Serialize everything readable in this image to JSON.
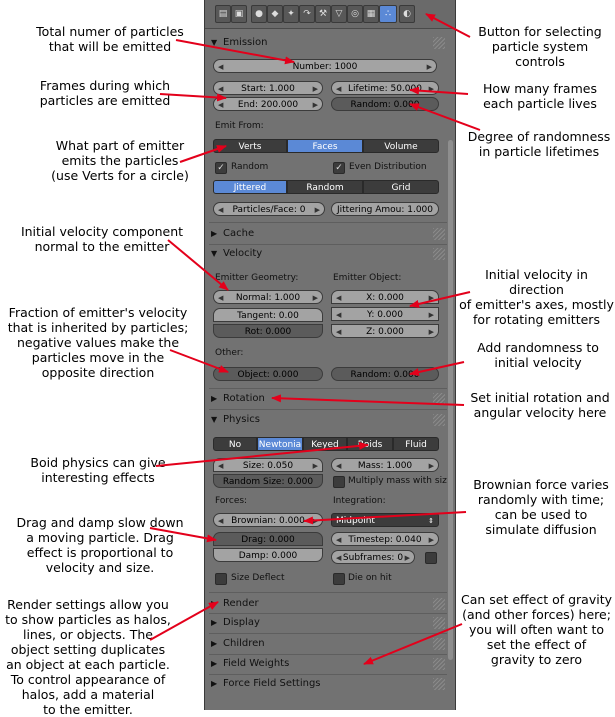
{
  "annotations": {
    "total_particles": "Total numer of particles\nthat will be emitted",
    "frames_emitted": "Frames during which\nparticles are emitted",
    "emitter_part": "What part of emitter\nemits the particles\n(use Verts for a circle)",
    "initial_velocity_normal": "Initial velocity component\nnormal to the emitter",
    "fraction_velocity": "Fraction of emitter's velocity\nthat is inherited by particles;\nnegative values make the\nparticles move in the\nopposite direction",
    "boid": "Boid physics can give\ninteresting effects",
    "drag_damp": "Drag and damp slow down\na moving particle.  Drag\neffect is proportional to\nvelocity and size.",
    "render": "Render settings allow you\nto show particles as halos,\nlines, or objects.  The\nobject setting duplicates\nan object at each particle.\nTo control appearance of\nhalos, add a material\nto the emitter.",
    "button_select": "Button for selecting\nparticle system controls",
    "frames_lives": "How many frames\neach particle lives",
    "randomness_lifetime": "Degree of randomness\nin particle lifetimes",
    "emitter_axes": "Initial velocity in direction\nof emitter's axes, mostly\nfor rotating emitters",
    "add_randomness": "Add randomness to\ninitial velocity",
    "rotation": "Set initial rotation and\nangular velocity here",
    "brownian": "Brownian force varies\nrandomly with time;\ncan be used to\nsimulate diffusion",
    "gravity": "Can set effect of gravity\n(and other forces) here;\nyou will often want to\nset the effect of\ngravity to zero"
  },
  "panel": {
    "tabs": [
      "▤",
      "▣",
      "●",
      "◆",
      "✦",
      "↷",
      "⚒",
      "▽",
      "◎",
      "▦",
      "∴",
      "◐"
    ],
    "emission": {
      "title": "Emission",
      "number": "Number: 1000",
      "start": "Start: 1.000",
      "end": "End: 200.000",
      "lifetime": "Lifetime: 50.000",
      "random": "Random: 0.000",
      "emit_from": "Emit From:",
      "emit_options": [
        "Verts",
        "Faces",
        "Volume"
      ],
      "random_check": "Random",
      "even_distribution": "Even Distribution",
      "dist_options": [
        "Jittered",
        "Random",
        "Grid"
      ],
      "particles_face": "Particles/Face: 0",
      "jittering": "Jittering Amou: 1.000"
    },
    "cache": {
      "title": "Cache"
    },
    "velocity": {
      "title": "Velocity",
      "emitter_geometry": "Emitter Geometry:",
      "emitter_object": "Emitter Object:",
      "normal": "Normal: 1.000",
      "tangent": "Tangent: 0.00",
      "rot": "Rot: 0.000",
      "x": "X: 0.000",
      "y": "Y: 0.000",
      "z": "Z: 0.000",
      "other": "Other:",
      "object": "Object: 0.000",
      "random": "Random: 0.000"
    },
    "rotation": {
      "title": "Rotation"
    },
    "physics": {
      "title": "Physics",
      "types": [
        "No",
        "Newtonia",
        "Keyed",
        "Boids",
        "Fluid"
      ],
      "size": "Size: 0.050",
      "mass": "Mass: 1.000",
      "random_size": "Random Size: 0.000",
      "multiply_mass": "Multiply mass with siz",
      "forces": "Forces:",
      "integration": "Integration:",
      "brownian": "Brownian: 0.000",
      "integrator": "Midpoint",
      "drag": "Drag: 0.000",
      "timestep": "Timestep: 0.040",
      "damp": "Damp: 0.000",
      "subframes": "Subframes: 0",
      "size_deflect": "Size Deflect",
      "die_on_hit": "Die on hit"
    },
    "render": {
      "title": "Render"
    },
    "display": {
      "title": "Display"
    },
    "children": {
      "title": "Children"
    },
    "field_weights": {
      "title": "Field Weights"
    },
    "force_field": {
      "title": "Force Field Settings"
    }
  },
  "colors": {
    "panel": "#727272",
    "accent": "#5b89d6",
    "arrow": "#e3001b"
  }
}
